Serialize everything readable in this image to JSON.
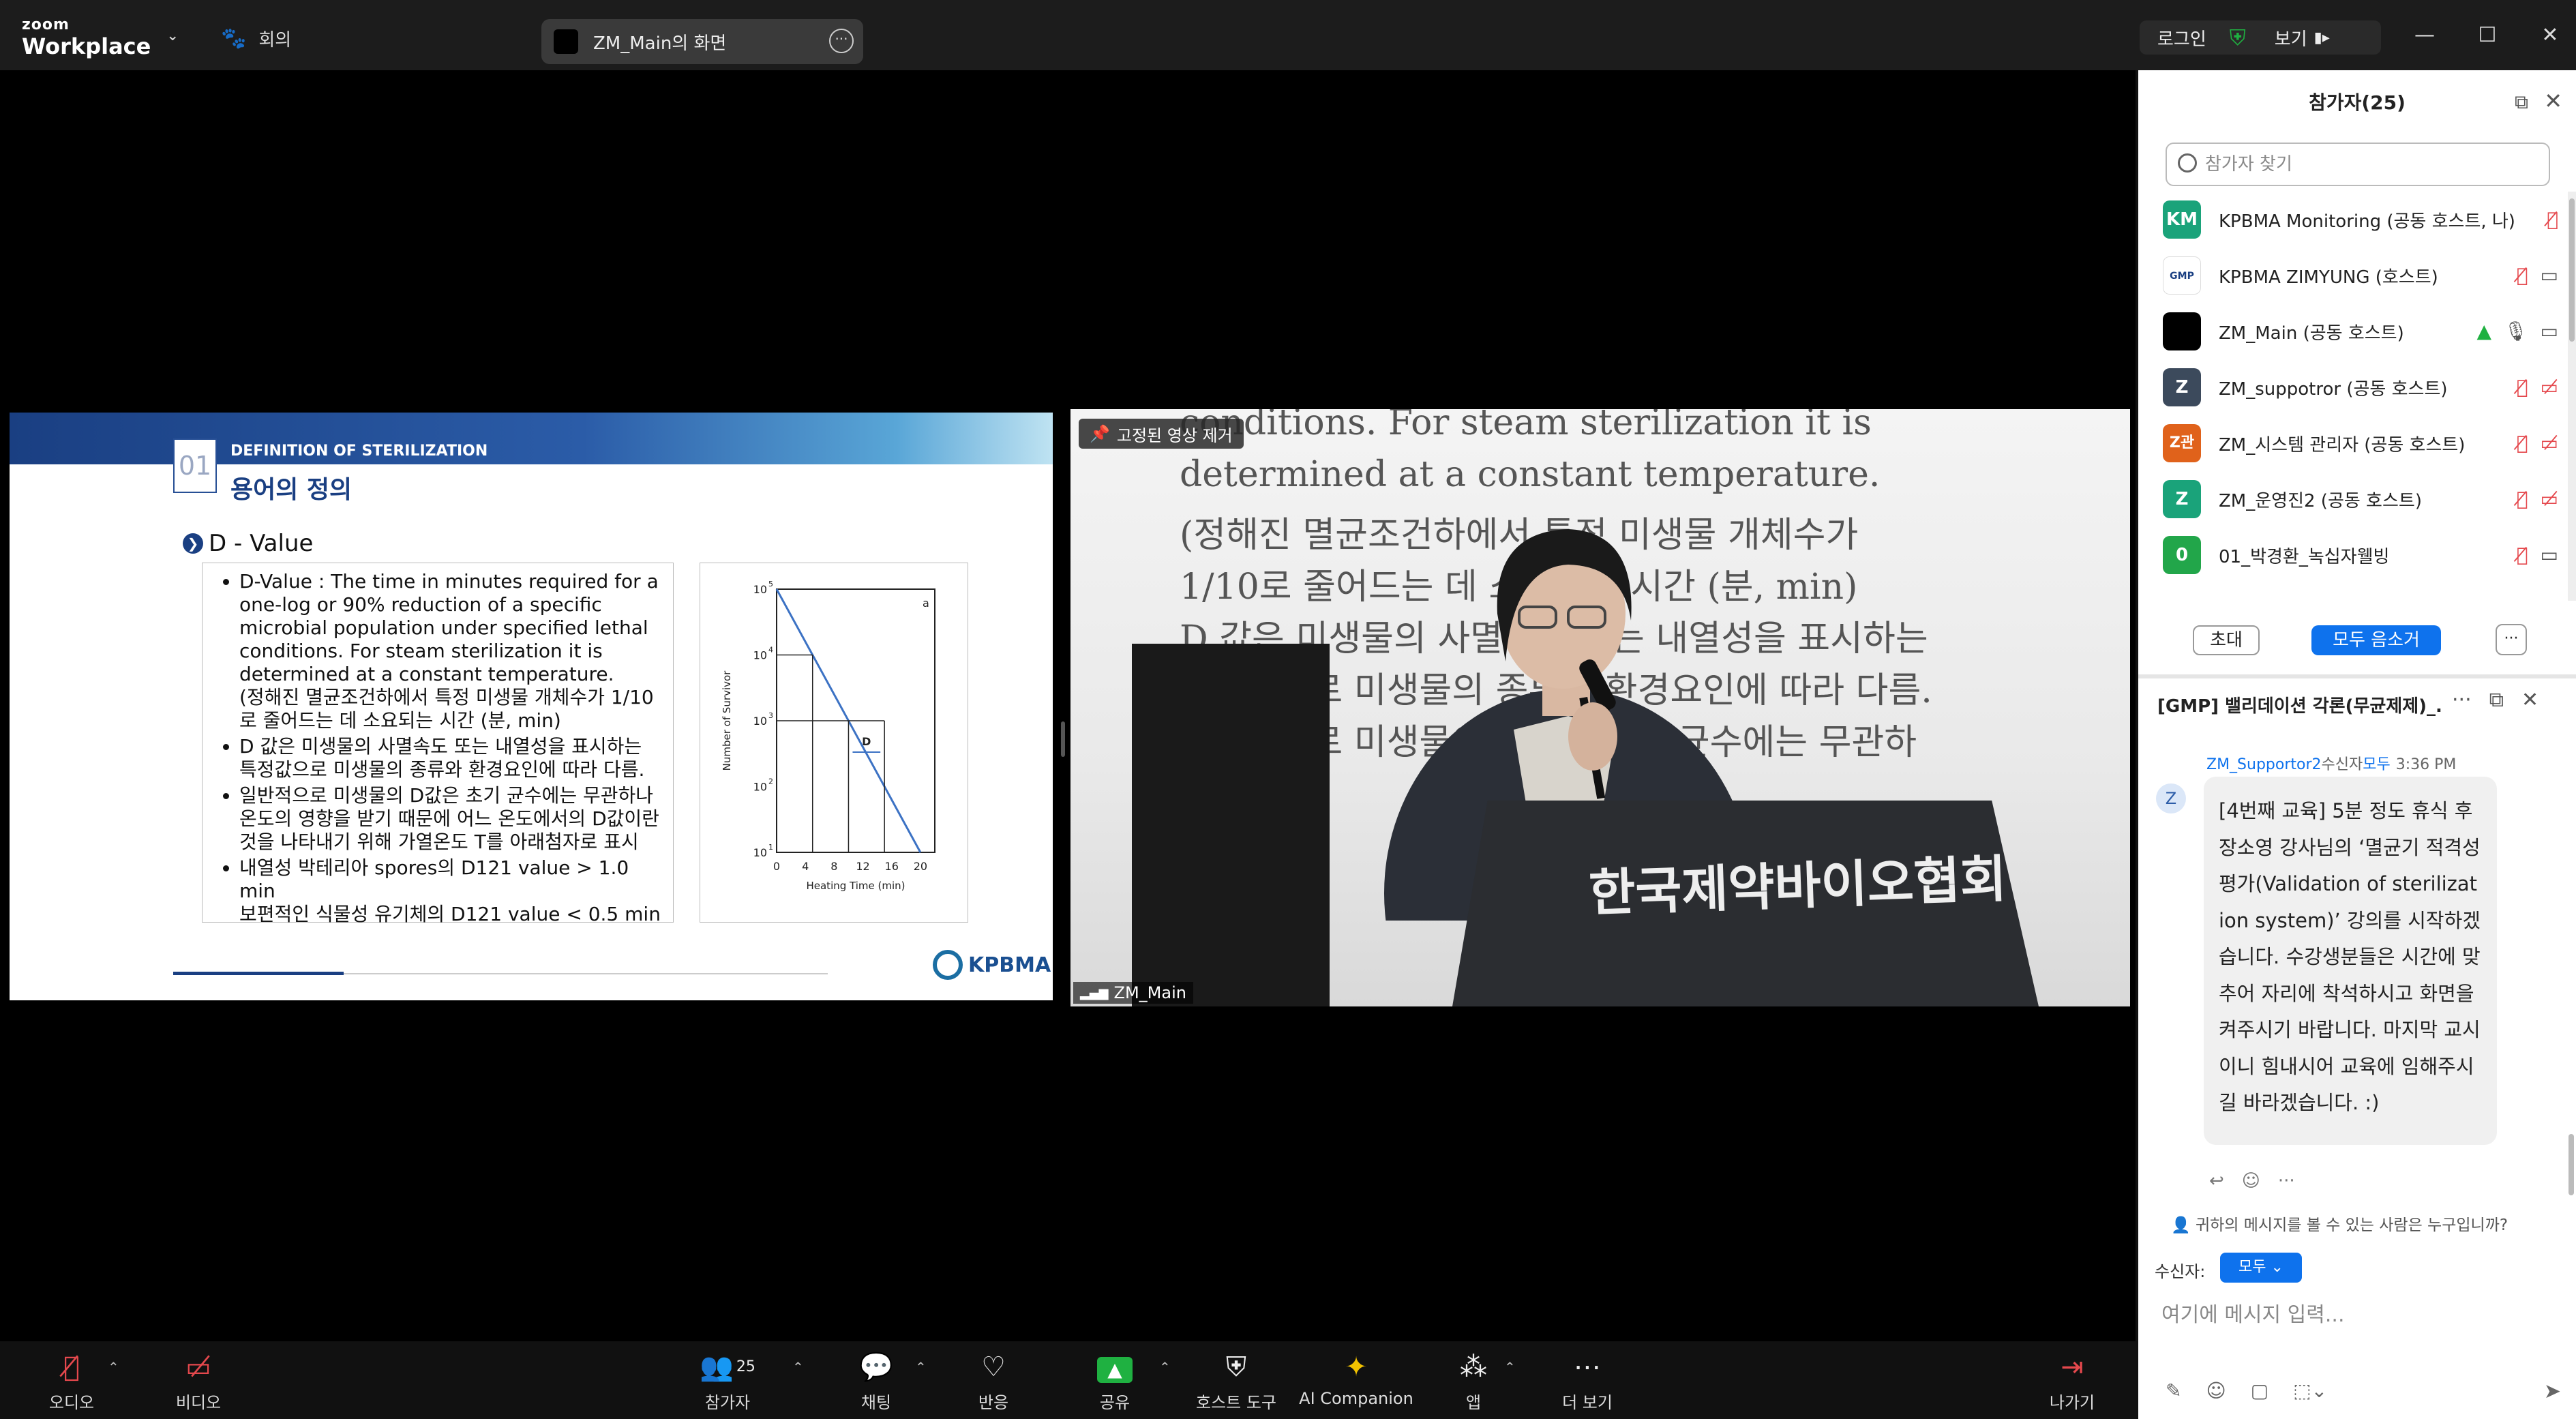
{
  "window": {
    "logo_line1": "zoom",
    "logo_line2": "Workplace",
    "meeting_label": "회의",
    "share_title": "ZM_Main의 화면",
    "login": "로그인",
    "view": "보기"
  },
  "slide": {
    "number": "01",
    "section": "DEFINITION OF STERILIZATION",
    "title": "용어의 정의",
    "subtitle": "D - Value",
    "bullets": [
      "D-Value : The time in minutes required for a one-log or 90% reduction of a specific microbial population under specified lethal conditions.  For steam sterilization it is determined at a constant temperature.",
      "D 값은 미생물의 사멸속도 또는 내열성을 표시하는 특정값으로 미생물의 종류와 환경요인에 따라 다름.",
      "일반적으로 미생물의 D값은 초기 균수에는 무관하나 온도의 영향을 받기 때문에 어느 온도에서의 D값이란 것을 나타내기 위해 가열온도 T를 아래첨자로 표시",
      "내열성 박테리아 spores의 D121 value > 1.0 min"
    ],
    "bullet1_korean": "(정해진 멸균조건하에서 특정 미생물 개체수가 1/10로 줄어드는 데 소요되는 시간 (분, min)",
    "bullet4_line2": "보편적인 식물성 유기체의 D121 value < 0.5 min",
    "logo_text": "KPBMA"
  },
  "chart_data": {
    "type": "line",
    "xlabel": "Heating Time (min)",
    "ylabel": "Number of Survivor",
    "x_ticks": [
      "0",
      "4",
      "8",
      "12",
      "16",
      "20"
    ],
    "y_ticks": [
      "10^1",
      "10^2",
      "10^3",
      "10^4",
      "10^5"
    ],
    "yscale": "log",
    "xlim": [
      0,
      22
    ],
    "series": [
      {
        "x": [
          0,
          20
        ],
        "y": [
          100000,
          10
        ]
      }
    ],
    "annotations": [
      "a",
      "D"
    ]
  },
  "speaker": {
    "unpin_label": "고정된 영상 제거",
    "name": "ZM_Main",
    "wall_lines": [
      "conditions.  For steam sterilization it is",
      "determined at a constant temperature.",
      "(정해진 멸균조건하에서 특정 미생물 개체수가",
      "1/10로 줄어드는 데 소요되는 시간 (분, min)",
      "D 값은 미생물의 사멸속도 또는 내열성을 표시하는",
      "특정값으로 미생물의 종류와 환경요인에 따라 다름.",
      "일반적으로 미생물의 D값은 초기 균수에는 무관하"
    ],
    "podium_text": "한국제약바이오협회"
  },
  "panel": {
    "title": "참가자(25)",
    "search_placeholder": "참가자 찾기",
    "participants": [
      {
        "initials": "KM",
        "name": "KPBMA Monitoring (공동 호스트, 나)",
        "color": "#1aa37a"
      },
      {
        "initials": "GMP",
        "name": "KPBMA ZIMYUNG (호스트)",
        "color": "#ffffff"
      },
      {
        "initials": "",
        "name": "ZM_Main (공동 호스트)",
        "color": "#000000"
      },
      {
        "initials": "Z",
        "name": "ZM_suppotror (공동 호스트)",
        "color": "#3c4a5c"
      },
      {
        "initials": "Z관",
        "name": "ZM_시스템 관리자 (공동 호스트)",
        "color": "#e0621b"
      },
      {
        "initials": "Z",
        "name": "ZM_운영진2 (공동 호스트)",
        "color": "#1aa37a"
      },
      {
        "initials": "0",
        "name": "01_박경환_녹십자웰빙",
        "color": "#22a64a"
      }
    ],
    "invite": "초대",
    "mute_all": "모두 음소거"
  },
  "chat": {
    "title": "[GMP] 밸리데이션 각론(무균제제)_...",
    "sender": "ZM_Supportor2",
    "receiver_label": "수신자",
    "recipient": "모두",
    "time": "3:36 PM",
    "avatar": "Z",
    "message": "[4번째 교육] 5분 정도 휴식 후 장소영 강사님의 ‘멸균기 적격성평가(Validation of sterilization system)’ 강의를 시작하겠습니다. 수강생분들은 시간에 맞추어 자리에 착석하시고 화면을 켜주시기 바랍니다. 마지막 교시이니 힘내시어 교육에 임해주시길 바라겠습니다. :)",
    "who_can_see": "귀하의 메시지를 볼 수 있는 사람은 누구입니까?",
    "to_label": "수신자:",
    "to_value": "모두",
    "input_placeholder": "여기에 메시지 입력..."
  },
  "toolbar": {
    "audio": "오디오",
    "video": "비디오",
    "participants": "참가자",
    "participants_count": "25",
    "chat": "채팅",
    "reactions": "반응",
    "share": "공유",
    "host_tools": "호스트 도구",
    "ai_companion": "AI Companion",
    "apps": "앱",
    "more": "더 보기",
    "leave": "나가기"
  },
  "colors": {
    "accent": "#0e72ed",
    "muted_red": "#e5484d",
    "share_green": "#1fb141"
  }
}
